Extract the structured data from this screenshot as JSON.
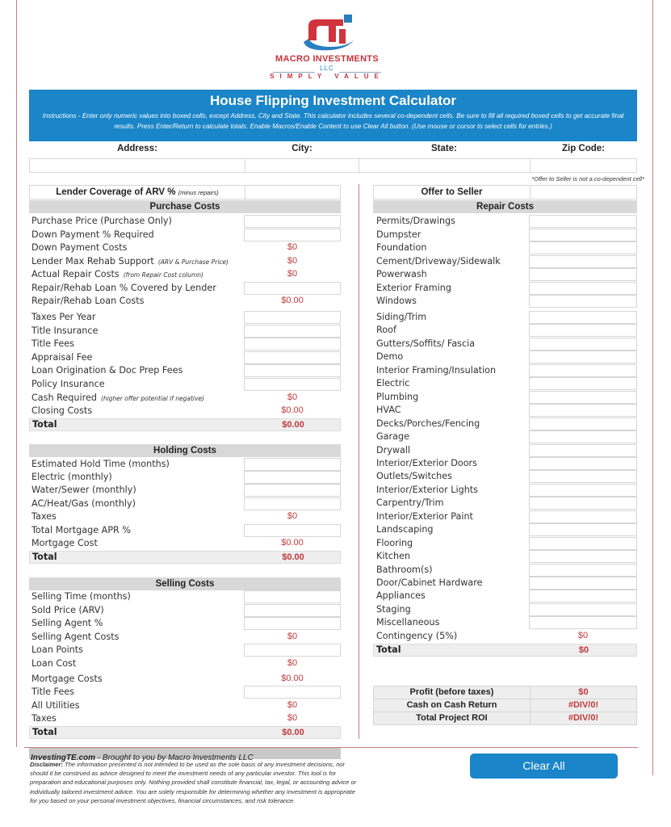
{
  "logo": {
    "company": "MACRO INVESTMENTS",
    "suffix": "LLC",
    "tagline": "SIMPLY VALUE",
    "brand_red": "#c8323c",
    "brand_blue": "#2a7fc0"
  },
  "banner": {
    "title": "House Flipping Investment Calculator",
    "instructions": "Instructions - Enter only numeric values into boxed cells, except Address, City and State. This calculator includes several co-dependent cells. Be sure to fill all required boxed cells to get accurate final results. Press Enter/Return to calculate totals. Enable Macros/Enable Content to use Clear All button. (Use mouse or cursor to select cells for entries.)",
    "color": "#1a85c8"
  },
  "address": {
    "address_label": "Address:",
    "city_label": "City:",
    "state_label": "State:",
    "zip_label": "Zip Code:",
    "address_value": "",
    "city_value": "",
    "state_value": "",
    "zip_value": ""
  },
  "note": "*Offer to Seller is not a co-dependent cell*",
  "lender_coverage": {
    "label": "Lender Coverage of ARV %",
    "note": "(minus repairs)",
    "value": ""
  },
  "offer_to_seller": {
    "label": "Offer to Seller",
    "value": ""
  },
  "purchase_costs": {
    "heading": "Purchase Costs",
    "rows": [
      {
        "label": "Purchase Price (Purchase Only)",
        "note": "",
        "type": "input",
        "value": ""
      },
      {
        "label": "Down Payment % Required",
        "note": "",
        "type": "input",
        "value": ""
      },
      {
        "label": "Down Payment Costs",
        "note": "",
        "type": "calc",
        "value": "$0"
      },
      {
        "label": "Lender Max Rehab Support",
        "note": "(ARV & Purchase Price)",
        "type": "calc",
        "value": "$0"
      },
      {
        "label": "Actual Repair Costs",
        "note": "(from Repair Cost column)",
        "type": "calc",
        "value": "$0"
      },
      {
        "label": "Repair/Rehab Loan % Covered by Lender",
        "note": "",
        "type": "input",
        "value": ""
      },
      {
        "label": "Repair/Rehab Loan Costs",
        "note": "",
        "type": "calc",
        "value": "$0.00"
      },
      {
        "label": "Taxes Per Year",
        "note": "",
        "type": "input",
        "value": ""
      },
      {
        "label": "Title Insurance",
        "note": "",
        "type": "input",
        "value": ""
      },
      {
        "label": "Title Fees",
        "note": "",
        "type": "input",
        "value": ""
      },
      {
        "label": "Appraisal Fee",
        "note": "",
        "type": "input",
        "value": ""
      },
      {
        "label": "Loan Origination & Doc Prep Fees",
        "note": "",
        "type": "input",
        "value": ""
      },
      {
        "label": "Policy Insurance",
        "note": "",
        "type": "input",
        "value": ""
      },
      {
        "label": "Cash Required",
        "note": "(higher offer potential if negative)",
        "type": "calc",
        "value": "$0"
      },
      {
        "label": "Closing Costs",
        "note": "",
        "type": "calc",
        "value": "$0.00"
      }
    ],
    "total_label": "Total",
    "total_value": "$0.00"
  },
  "holding_costs": {
    "heading": "Holding Costs",
    "rows": [
      {
        "label": "Estimated Hold Time (months)",
        "type": "input",
        "value": ""
      },
      {
        "label": "Electric (monthly)",
        "type": "input",
        "value": ""
      },
      {
        "label": "Water/Sewer (monthly)",
        "type": "input",
        "value": ""
      },
      {
        "label": "AC/Heat/Gas (monthly)",
        "type": "input",
        "value": ""
      },
      {
        "label": "Taxes",
        "type": "calc",
        "value": "$0"
      },
      {
        "label": "Total Mortgage APR %",
        "type": "input",
        "value": ""
      },
      {
        "label": "Mortgage Cost",
        "type": "calc",
        "value": "$0.00"
      }
    ],
    "total_label": "Total",
    "total_value": "$0.00"
  },
  "selling_costs": {
    "heading": "Selling Costs",
    "rows": [
      {
        "label": "Selling Time (months)",
        "type": "input",
        "value": ""
      },
      {
        "label": "Sold Price (ARV)",
        "type": "input",
        "value": ""
      },
      {
        "label": "Selling Agent %",
        "type": "input",
        "value": ""
      },
      {
        "label": "Selling Agent Costs",
        "type": "calc",
        "value": "$0"
      },
      {
        "label": "Loan Points",
        "type": "input",
        "value": ""
      },
      {
        "label": "Loan Cost",
        "type": "calc",
        "value": "$0"
      },
      {
        "label": "Mortgage Costs",
        "type": "calc",
        "value": "$0.00"
      },
      {
        "label": "Title Fees",
        "type": "input",
        "value": ""
      },
      {
        "label": "All Utilities",
        "type": "calc",
        "value": "$0"
      },
      {
        "label": "Taxes",
        "type": "calc",
        "value": "$0"
      }
    ],
    "total_label": "Total",
    "total_value": "$0.00"
  },
  "repair_costs": {
    "heading": "Repair Costs",
    "rows": [
      {
        "label": "Permits/Drawings",
        "type": "input",
        "value": ""
      },
      {
        "label": "Dumpster",
        "type": "input",
        "value": ""
      },
      {
        "label": "Foundation",
        "type": "input",
        "value": ""
      },
      {
        "label": "Cement/Driveway/Sidewalk",
        "type": "input",
        "value": ""
      },
      {
        "label": "Powerwash",
        "type": "input",
        "value": ""
      },
      {
        "label": "Exterior Framing",
        "type": "input",
        "value": ""
      },
      {
        "label": "Windows",
        "type": "input",
        "value": ""
      },
      {
        "label": "Siding/Trim",
        "type": "input",
        "value": ""
      },
      {
        "label": "Roof",
        "type": "input",
        "value": ""
      },
      {
        "label": "Gutters/Soffits/ Fascia",
        "type": "input",
        "value": ""
      },
      {
        "label": "Demo",
        "type": "input",
        "value": ""
      },
      {
        "label": "Interior Framing/Insulation",
        "type": "input",
        "value": ""
      },
      {
        "label": "Electric",
        "type": "input",
        "value": ""
      },
      {
        "label": "Plumbing",
        "type": "input",
        "value": ""
      },
      {
        "label": "HVAC",
        "type": "input",
        "value": ""
      },
      {
        "label": "Decks/Porches/Fencing",
        "type": "input",
        "value": ""
      },
      {
        "label": "Garage",
        "type": "input",
        "value": ""
      },
      {
        "label": "Drywall",
        "type": "input",
        "value": ""
      },
      {
        "label": "Interior/Exterior Doors",
        "type": "input",
        "value": ""
      },
      {
        "label": "Outlets/Switches",
        "type": "input",
        "value": ""
      },
      {
        "label": "Interior/Exterior Lights",
        "type": "input",
        "value": ""
      },
      {
        "label": "Carpentry/Trim",
        "type": "input",
        "value": ""
      },
      {
        "label": "Interior/Exterior Paint",
        "type": "input",
        "value": ""
      },
      {
        "label": "Landscaping",
        "type": "input",
        "value": ""
      },
      {
        "label": "Flooring",
        "type": "input",
        "value": ""
      },
      {
        "label": "Kitchen",
        "type": "input",
        "value": ""
      },
      {
        "label": "Bathroom(s)",
        "type": "input",
        "value": ""
      },
      {
        "label": "Door/Cabinet Hardware",
        "type": "input",
        "value": ""
      },
      {
        "label": "Appliances",
        "type": "input",
        "value": ""
      },
      {
        "label": "Staging",
        "type": "input",
        "value": ""
      },
      {
        "label": "Miscellaneous",
        "type": "input",
        "value": ""
      },
      {
        "label": "Contingency (5%)",
        "type": "calc",
        "value": "$0"
      }
    ],
    "total_label": "Total",
    "total_value": "$0"
  },
  "summary": [
    {
      "label": "Profit (before taxes)",
      "value": "$0"
    },
    {
      "label": "Cash on Cash Return",
      "value": "#DIV/0!"
    },
    {
      "label": "Total Project ROI",
      "value": "#DIV/0!"
    }
  ],
  "footer": {
    "site": "InvestingTE.com",
    "byline": " - Brought to you by Macro Investments LLC",
    "disclaimer_label": "Disclaimer:",
    "disclaimer_text": " The information presented is not intended to be used as the sole basis of any investment decisions, nor should it be construed as advice designed to meet the investment needs of any particular investor. This tool is for preparation and educational purposes only. Nothing provided shall constitute financial, tax, legal, or accounting advice or individually tailored investment advice. You are solely responsible for determining whether any investment is appropriate for you based on your personal investment objectives, financial circumstances, and risk tolerance."
  },
  "buttons": {
    "clear_all": "Clear All"
  },
  "value_color": "#c0393b"
}
